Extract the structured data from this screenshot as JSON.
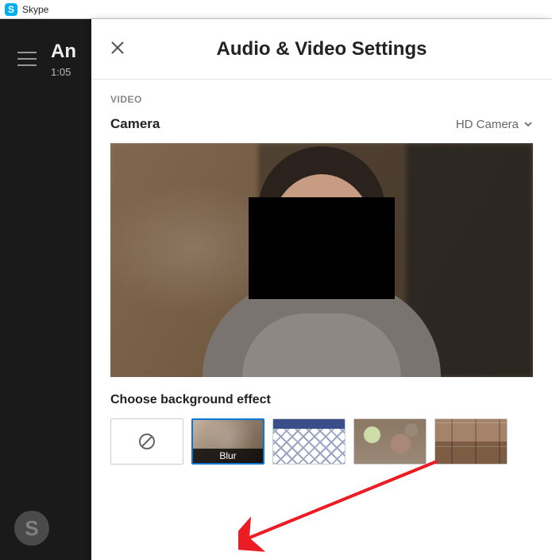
{
  "titlebar": {
    "app_name": "Skype"
  },
  "call": {
    "contact_name": "An",
    "duration": "1:05"
  },
  "panel": {
    "title": "Audio & Video Settings",
    "video_section_label": "VIDEO",
    "camera_label": "Camera",
    "camera_selected": "HD Camera",
    "effects_label": "Choose background effect",
    "effects": {
      "none": "None",
      "blur": "Blur"
    }
  }
}
